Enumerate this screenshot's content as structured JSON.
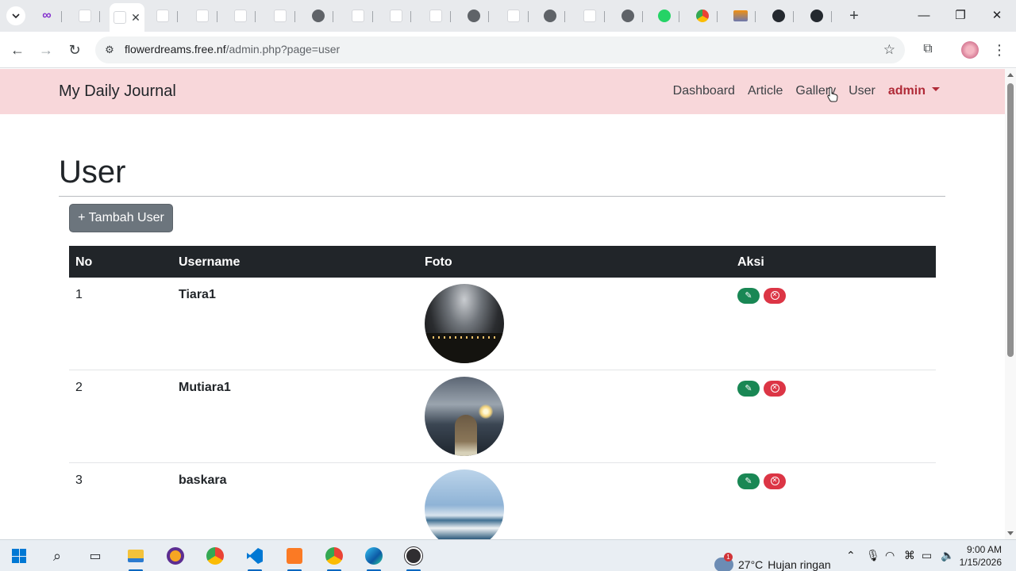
{
  "browser": {
    "active_tab_close": "✕",
    "new_tab": "+",
    "url_host": "flowerdreams.free.nf",
    "url_path": "/admin.php?page=user",
    "window_controls": [
      "—",
      "❐",
      "✕"
    ]
  },
  "site": {
    "brand": "My Daily Journal",
    "nav": [
      {
        "label": "Dashboard"
      },
      {
        "label": "Article"
      },
      {
        "label": "Gallery"
      },
      {
        "label": "User"
      }
    ],
    "user_menu": "admin",
    "colors": {
      "navbar_bg": "#f8d7da",
      "admin": "#b02a37",
      "edit": "#198754",
      "delete": "#dc3545"
    }
  },
  "page": {
    "title": "User",
    "add_button": "+ Tambah User"
  },
  "table": {
    "headers": [
      "No",
      "Username",
      "Foto",
      "Aksi"
    ],
    "rows": [
      {
        "no": "1",
        "username": "Tiara1",
        "photo": "night-city-clouds"
      },
      {
        "no": "2",
        "username": "Mutiara1",
        "photo": "girl-sunset-clouds"
      },
      {
        "no": "3",
        "username": "baskara",
        "photo": "sea-waves"
      }
    ]
  },
  "taskbar": {
    "weather_temp": "27°C",
    "weather_desc": "Hujan ringan",
    "weather_badge": "1",
    "time": "9:00 AM",
    "date": "1/15/2026"
  }
}
